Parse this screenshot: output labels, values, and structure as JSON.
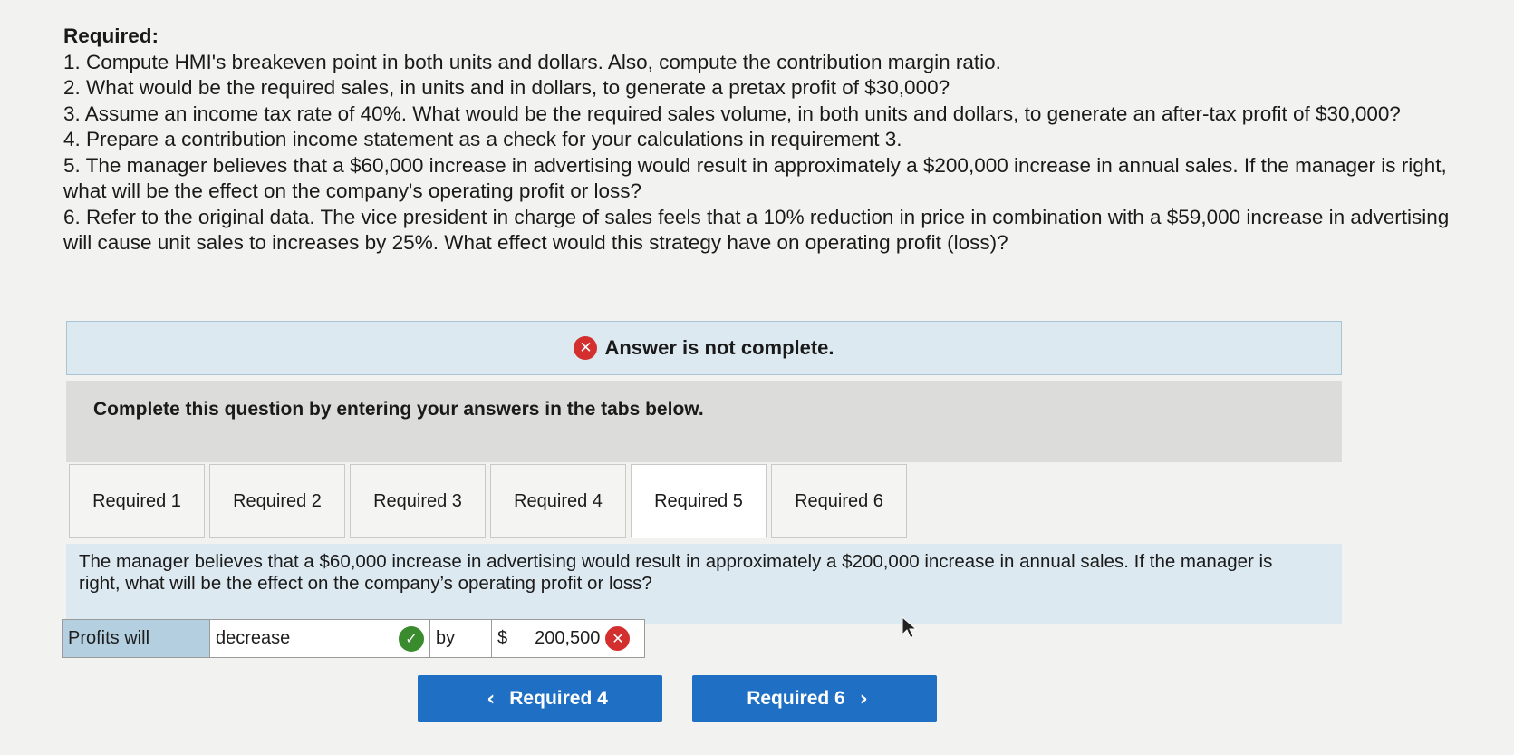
{
  "requirements": {
    "heading": "Required:",
    "items": [
      "1. Compute HMI's breakeven point in both units and dollars. Also, compute the contribution margin ratio.",
      "2. What would be the required sales, in units and in dollars, to generate a pretax profit of $30,000?",
      "3. Assume an income tax rate of 40%. What would be the required sales volume, in both units and dollars, to generate an after-tax profit of $30,000?",
      "4. Prepare a contribution income statement as a check for your calculations in requirement 3.",
      "5. The manager believes that a $60,000 increase in advertising would result in approximately a $200,000 increase in annual sales. If the manager is right, what will be the effect on the company's operating profit or loss?",
      "6. Refer to the original data. The vice president in charge of sales feels that a 10% reduction in price in combination with a $59,000 increase in advertising will cause unit sales to increases by 25%. What effect would this strategy have on operating profit (loss)?"
    ]
  },
  "banner": {
    "text": "Answer is not complete.",
    "icon": "x-circle-icon",
    "color": "#d32f2f"
  },
  "instruction": "Complete this question by entering your answers in the tabs below.",
  "tabs": [
    {
      "label": "Required 1",
      "active": false
    },
    {
      "label": "Required 2",
      "active": false
    },
    {
      "label": "Required 3",
      "active": false
    },
    {
      "label": "Required 4",
      "active": false
    },
    {
      "label": "Required 5",
      "active": true
    },
    {
      "label": "Required 6",
      "active": false
    }
  ],
  "question": "The manager believes that a $60,000 increase in advertising would result in approximately a $200,000 increase in annual sales. If the manager is right, what will be the effect on the company’s operating profit or loss?",
  "answer": {
    "label": "Profits will",
    "selected": "decrease",
    "selected_status": "correct",
    "by_label": "by",
    "currency": "$",
    "amount": "200,500",
    "amount_status": "incorrect"
  },
  "nav": {
    "prev_label": "Required 4",
    "next_label": "Required 6",
    "color": "#1f6fc5"
  }
}
